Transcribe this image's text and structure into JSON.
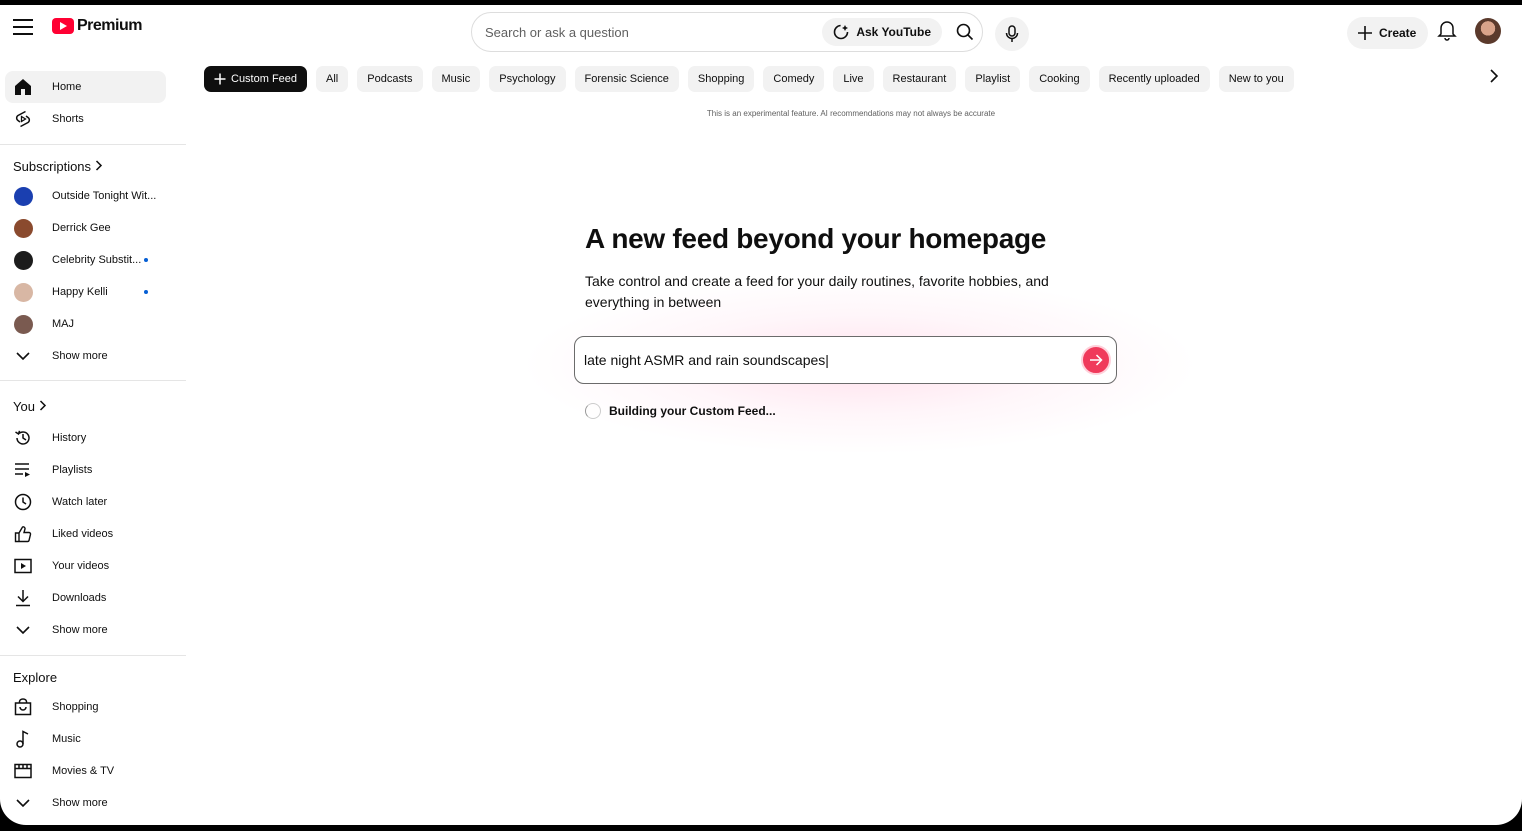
{
  "topbar": {
    "logo_text": "Premium",
    "search_placeholder": "Search or ask a question",
    "ask_label": "Ask YouTube",
    "create_label": "Create"
  },
  "sidebar": {
    "main": [
      {
        "label": "Home",
        "icon": "home-icon",
        "active": true
      },
      {
        "label": "Shorts",
        "icon": "shorts-icon"
      }
    ],
    "subscriptions_title": "Subscriptions",
    "subscriptions": [
      {
        "label": "Outside Tonight Wit...",
        "color": "#1a3fb0",
        "new": false
      },
      {
        "label": "Derrick Gee",
        "color": "#8a4a2e",
        "new": false
      },
      {
        "label": "Celebrity Substit...",
        "color": "#1c1c1c",
        "new": true
      },
      {
        "label": "Happy Kelli",
        "color": "#d8b7a4",
        "new": true
      },
      {
        "label": "MAJ",
        "color": "#7a5a50",
        "new": false
      }
    ],
    "subscriptions_more": "Show more",
    "you_title": "You",
    "you": [
      {
        "label": "History",
        "icon": "history-icon"
      },
      {
        "label": "Playlists",
        "icon": "playlists-icon"
      },
      {
        "label": "Watch later",
        "icon": "clock-icon"
      },
      {
        "label": "Liked videos",
        "icon": "thumbs-up-icon"
      },
      {
        "label": "Your videos",
        "icon": "play-square-icon"
      },
      {
        "label": "Downloads",
        "icon": "download-icon"
      }
    ],
    "you_more": "Show more",
    "explore_title": "Explore",
    "explore": [
      {
        "label": "Shopping",
        "icon": "shopping-bag-icon"
      },
      {
        "label": "Music",
        "icon": "music-note-icon"
      },
      {
        "label": "Movies & TV",
        "icon": "film-icon"
      }
    ],
    "explore_more": "Show more"
  },
  "chips": {
    "custom_feed": "Custom Feed",
    "items": [
      "All",
      "Podcasts",
      "Music",
      "Psychology",
      "Forensic Science",
      "Shopping",
      "Comedy",
      "Live",
      "Restaurant",
      "Playlist",
      "Cooking",
      "Recently uploaded",
      "New to you"
    ]
  },
  "disclaimer": "This is an experimental feature. AI recommendations may not always be accurate",
  "main": {
    "headline": "A new feed beyond your homepage",
    "subline": "Take control and create a feed for your daily routines, favorite hobbies, and everything in between",
    "prompt_value": "late night ASMR and rain soundscapes|",
    "status": "Building your Custom Feed..."
  },
  "colors": {
    "brand_red": "#ff0033",
    "send_button": "#f03a5b",
    "notification_dot": "#065fd4"
  }
}
